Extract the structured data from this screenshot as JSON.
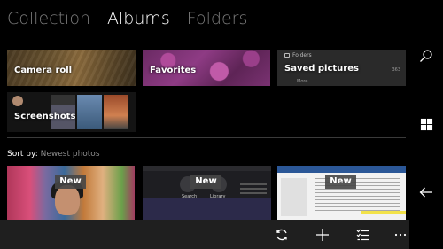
{
  "pivot": {
    "tabs": [
      {
        "label": "Collection"
      },
      {
        "label": "Albums"
      },
      {
        "label": "Folders"
      }
    ]
  },
  "albums": {
    "camera_roll": "Camera roll",
    "favorites": "Favorites",
    "saved_pictures": {
      "label": "Saved pictures",
      "folders_tag": "Folders",
      "count": "363",
      "more": "More"
    },
    "screenshots": "Screenshots"
  },
  "sort": {
    "label": "Sort by:",
    "value": "Newest photos"
  },
  "photos": {
    "badge": "New",
    "screenshot_labels": [
      "Search",
      "Library"
    ]
  },
  "appbar": {
    "icons": [
      "sync-icon",
      "add-icon",
      "select-icon",
      "more-icon"
    ]
  },
  "navbar": {
    "icons": [
      "search-icon",
      "windows-icon",
      "back-icon"
    ]
  }
}
